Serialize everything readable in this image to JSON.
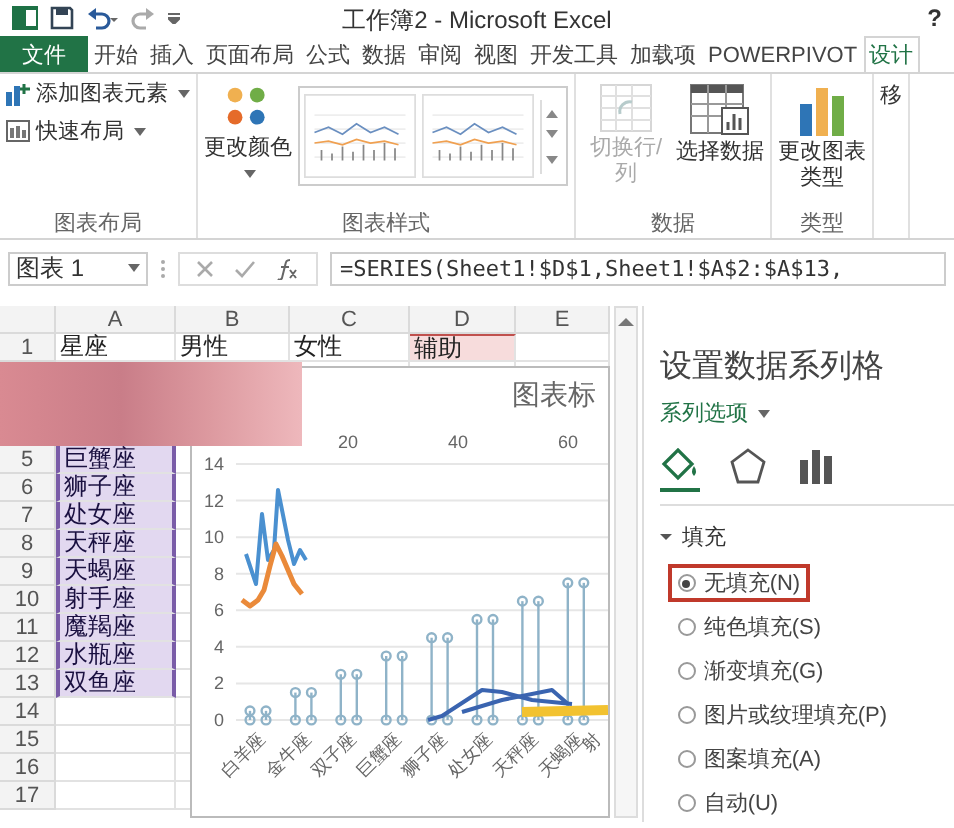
{
  "window": {
    "title": "工作簿2 - Microsoft Excel",
    "help": "?"
  },
  "ribbon_tabs": [
    {
      "label": "文件",
      "kind": "file",
      "selected": false
    },
    {
      "label": "开始",
      "kind": "tab",
      "selected": false
    },
    {
      "label": "插入",
      "kind": "tab",
      "selected": false
    },
    {
      "label": "页面布局",
      "kind": "tab",
      "selected": false
    },
    {
      "label": "公式",
      "kind": "tab",
      "selected": false
    },
    {
      "label": "数据",
      "kind": "tab",
      "selected": false
    },
    {
      "label": "审阅",
      "kind": "tab",
      "selected": false
    },
    {
      "label": "视图",
      "kind": "tab",
      "selected": false
    },
    {
      "label": "开发工具",
      "kind": "tab",
      "selected": false
    },
    {
      "label": "加载项",
      "kind": "tab",
      "selected": false
    },
    {
      "label": "POWERPIVOT",
      "kind": "tab",
      "selected": false
    },
    {
      "label": "设计",
      "kind": "tab",
      "selected": true
    }
  ],
  "ribbon_groups": [
    {
      "label": "图表布局",
      "commands": [
        {
          "kind": "small",
          "label": "添加图表元素",
          "dropdown": true,
          "disabled": false
        },
        {
          "kind": "small",
          "label": "快速布局",
          "dropdown": true,
          "disabled": false
        }
      ]
    },
    {
      "label": "图表样式",
      "commands": [
        {
          "kind": "large",
          "label": "更改颜色",
          "dropdown": true,
          "disabled": false
        },
        {
          "kind": "gallery"
        }
      ]
    },
    {
      "label": "数据",
      "commands": [
        {
          "kind": "large",
          "label": "切换行/列",
          "dropdown": false,
          "disabled": true
        },
        {
          "kind": "large",
          "label": "选择数据",
          "dropdown": false,
          "disabled": false
        }
      ]
    },
    {
      "label": "类型",
      "commands": [
        {
          "kind": "large",
          "label": "更改图表类型",
          "dropdown": false,
          "disabled": false
        }
      ]
    },
    {
      "commands": [
        {
          "kind": "large",
          "label": "移",
          "dropdown": false,
          "disabled": false
        }
      ]
    }
  ],
  "formula_bar": {
    "name_box": "图表 1",
    "formula": "=SERIES(Sheet1!$D$1,Sheet1!$A$2:$A$13,"
  },
  "sheet": {
    "columns": [
      "A",
      "B",
      "C",
      "D",
      "E"
    ],
    "rows": [
      {
        "header": "1",
        "cells": [
          {
            "text": "星座",
            "highlight": false
          },
          {
            "text": "男性",
            "highlight": false
          },
          {
            "text": "女性",
            "highlight": false
          },
          {
            "text": "辅助",
            "highlight": true
          }
        ],
        "in_range": false,
        "redacted": false
      },
      {
        "redacted": true
      },
      {
        "redacted": true
      },
      {
        "redacted": true
      },
      {
        "header": "5",
        "cells": [
          {
            "text": "巨蟹座",
            "highlight": false
          }
        ],
        "in_range": true,
        "redacted": false
      },
      {
        "header": "6",
        "cells": [
          {
            "text": "狮子座",
            "highlight": false
          }
        ],
        "in_range": true,
        "redacted": false
      },
      {
        "header": "7",
        "cells": [
          {
            "text": "处女座",
            "highlight": false
          }
        ],
        "in_range": true,
        "redacted": false
      },
      {
        "header": "8",
        "cells": [
          {
            "text": "天秤座",
            "highlight": false
          }
        ],
        "in_range": true,
        "redacted": false
      },
      {
        "header": "9",
        "cells": [
          {
            "text": "天蝎座",
            "highlight": false
          }
        ],
        "in_range": true,
        "redacted": false
      },
      {
        "header": "10",
        "cells": [
          {
            "text": "射手座",
            "highlight": false
          }
        ],
        "in_range": true,
        "redacted": false
      },
      {
        "header": "11",
        "cells": [
          {
            "text": "魔羯座",
            "highlight": false
          }
        ],
        "in_range": true,
        "redacted": false
      },
      {
        "header": "12",
        "cells": [
          {
            "text": "水瓶座",
            "highlight": false
          }
        ],
        "in_range": true,
        "redacted": false
      },
      {
        "header": "13",
        "cells": [
          {
            "text": "双鱼座",
            "highlight": false
          }
        ],
        "in_range": true,
        "redacted": false
      },
      {
        "header": "14",
        "in_range": false,
        "redacted": false
      },
      {
        "header": "15",
        "in_range": false,
        "redacted": false
      },
      {
        "header": "16",
        "in_range": false,
        "redacted": false
      },
      {
        "header": "17",
        "in_range": false,
        "redacted": false
      }
    ]
  },
  "chart": {
    "title": "图表标",
    "top_axis_labels": [
      "20",
      "40",
      "60"
    ],
    "y_axis_labels": [
      "14",
      "12",
      "10",
      "8",
      "6",
      "4",
      "2",
      "0"
    ],
    "category_labels": [
      "白羊座",
      "金牛座",
      "双子座",
      "巨蟹座",
      "狮子座",
      "处女座",
      "天秤座",
      "天蝎座",
      "射"
    ]
  },
  "pane": {
    "title": "设置数据系列格",
    "options_label": "系列选项",
    "tabs": [
      {
        "selected": true
      },
      {
        "selected": false
      },
      {
        "selected": false
      }
    ],
    "section": {
      "label": "填充",
      "expanded": true,
      "options": [
        {
          "label": "无填充(N)",
          "selected": true,
          "highlighted": true
        },
        {
          "label": "纯色填充(S)",
          "selected": false,
          "highlighted": false
        },
        {
          "label": "渐变填充(G)",
          "selected": false,
          "highlighted": false
        },
        {
          "label": "图片或纹理填充(P)",
          "selected": false,
          "highlighted": false
        },
        {
          "label": "图案填充(A)",
          "selected": false,
          "highlighted": false
        },
        {
          "label": "自动(U)",
          "selected": false,
          "highlighted": false
        }
      ]
    }
  }
}
